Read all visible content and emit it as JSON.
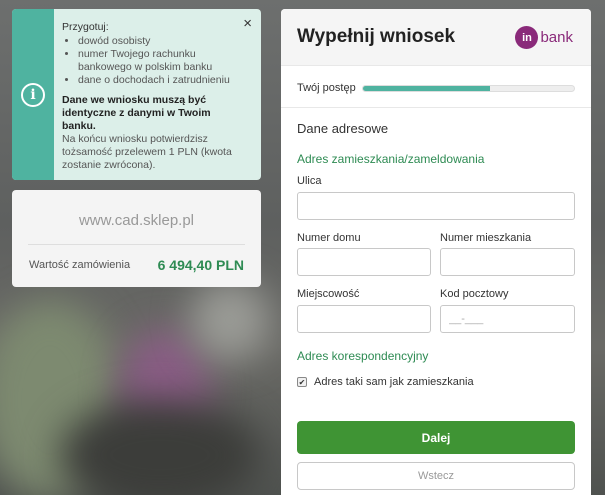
{
  "info": {
    "heading": "Przygotuj:",
    "items": [
      "dowód osobisty",
      "numer Twojego rachunku bankowego w polskim banku",
      "dane o dochodach i zatrudnieniu"
    ],
    "bold_text": "Dane we wniosku muszą być identyczne z danymi w Twoim banku.",
    "note": "Na końcu wniosku potwierdzisz tożsamość przelewem 1 PLN (kwota zostanie zwrócona).",
    "close_symbol": "×",
    "icon_symbol": "i"
  },
  "order": {
    "site": "www.cad.sklep.pl",
    "label": "Wartość zamówienia",
    "value": "6 494,40 PLN"
  },
  "form": {
    "title": "Wypełnij wniosek",
    "logo": {
      "mark": "in",
      "word": "bank",
      "color": "#8a2a7a"
    },
    "progress": {
      "label": "Twój postęp",
      "fraction": 0.6
    },
    "section_title": "Dane adresowe",
    "address_heading": "Adres zamieszkania/zameldowania",
    "fields": {
      "street_label": "Ulica",
      "street_value": "",
      "house_label": "Numer domu",
      "house_value": "",
      "apartment_label": "Numer mieszkania",
      "apartment_value": "",
      "city_label": "Miejscowość",
      "city_value": "",
      "postal_label": "Kod pocztowy",
      "postal_placeholder": "__-___",
      "postal_value": ""
    },
    "correspondence_heading": "Adres korespondencyjny",
    "same_address_label": "Adres taki sam jak zamieszkania",
    "same_address_checked": true,
    "next_button": "Dalej",
    "back_button": "Wstecz"
  },
  "colors": {
    "accent_green": "#2e8b53",
    "button_green": "#3f9434",
    "teal": "#4fb3a0"
  }
}
